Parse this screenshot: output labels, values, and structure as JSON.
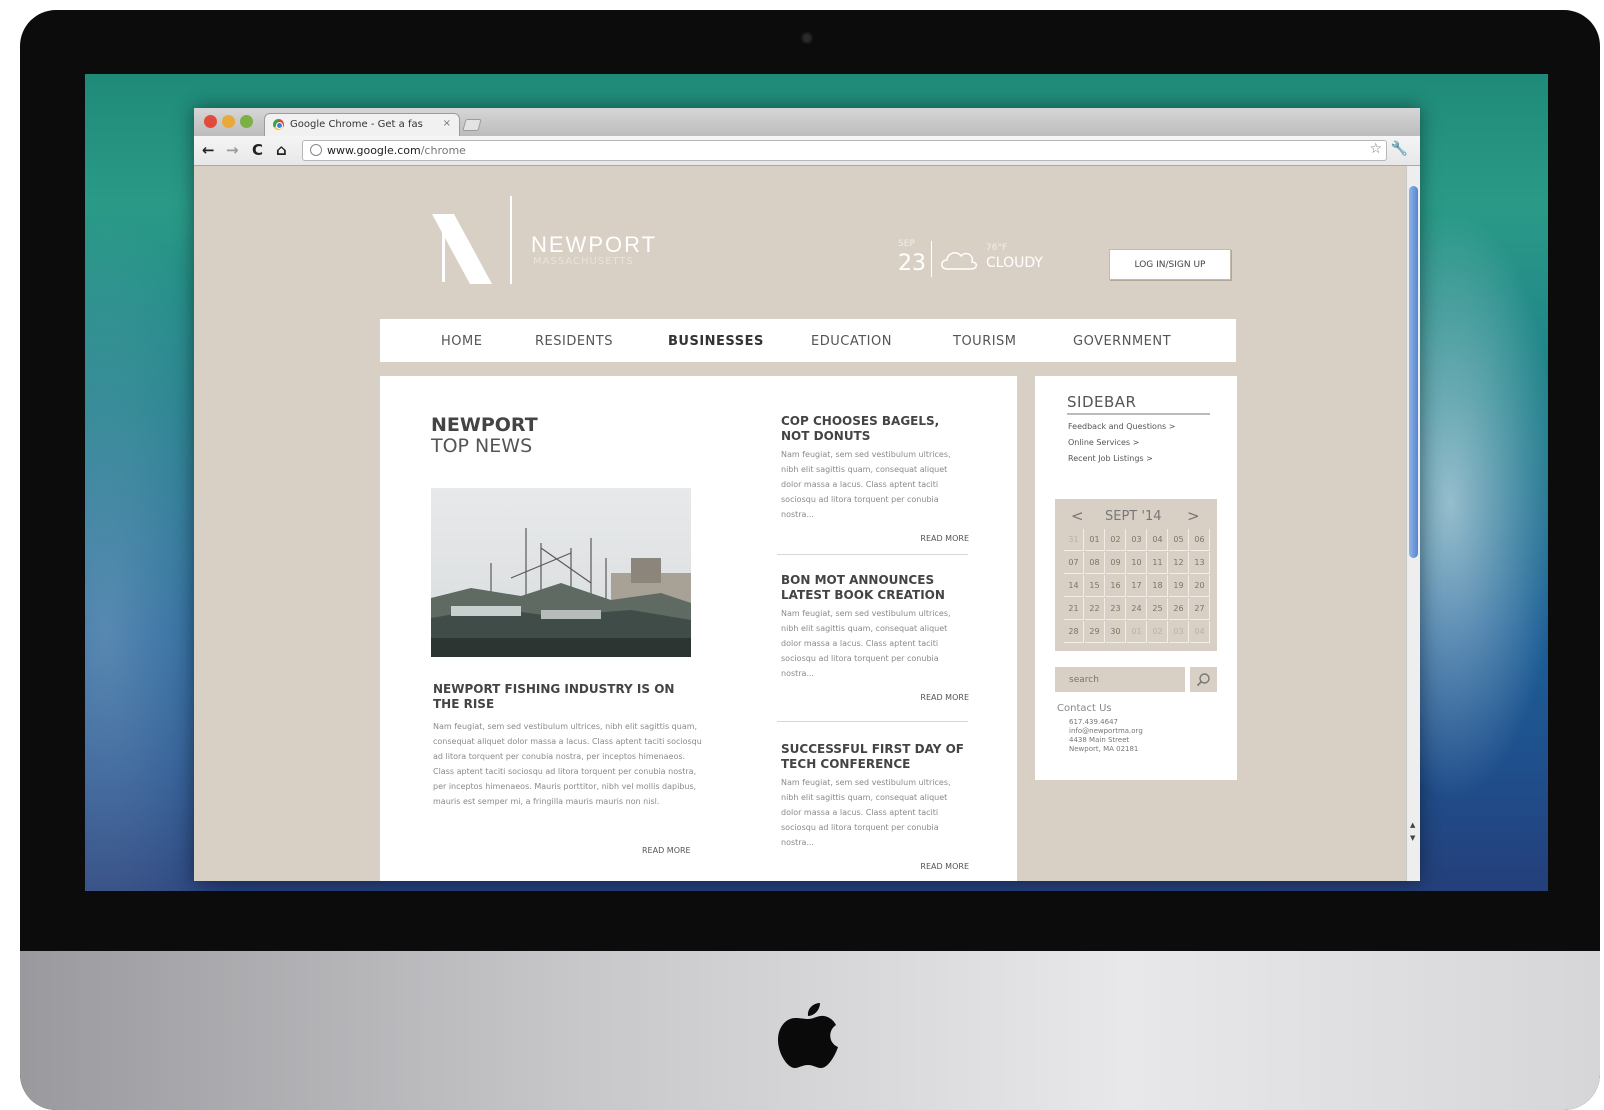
{
  "browser": {
    "tab_title": "Google Chrome - Get a fas",
    "tab_close": "×",
    "url_domain": "www.google.com",
    "url_path": "/chrome",
    "icons": [
      "back-icon",
      "forward-icon",
      "reload-icon",
      "home-icon",
      "star-icon",
      "wrench-icon"
    ]
  },
  "site": {
    "name": "NEWPORT",
    "subtitle": "MASSACHUSETTS",
    "login_label": "LOG IN/SIGN UP",
    "weather": {
      "month": "SEP",
      "day": "23",
      "temp": "76°F",
      "condition": "CLOUDY"
    },
    "colors": {
      "background": "#d8d0c4",
      "panel": "#ffffff",
      "text": "#444444"
    }
  },
  "nav": {
    "items": [
      "HOME",
      "RESIDENTS",
      "BUSINESSES",
      "EDUCATION",
      "TOURISM",
      "GOVERNMENT"
    ],
    "active": "BUSINESSES"
  },
  "main": {
    "heading_line1": "NEWPORT",
    "heading_line2": "TOP NEWS",
    "featured": {
      "title": "NEWPORT FISHING INDUSTRY IS ON THE RISE",
      "body": "Nam feugiat, sem sed vestibulum ultrices, nibh elit sagittis quam, consequat aliquet dolor massa a lacus. Class aptent taciti sociosqu ad litora torquent per conubia nostra, per inceptos himenaeos. Class aptent taciti sociosqu ad litora torquent per conubia nostra, per inceptos himenaeos. Mauris porttitor, nibh vel mollis dapibus, mauris est semper mi, a fringilla mauris mauris non nisl.",
      "more": "READ MORE"
    },
    "stories": [
      {
        "title": "COP CHOOSES BAGELS, NOT DONUTS",
        "body": "Nam feugiat, sem sed vestibulum ultrices, nibh elit sagittis quam, consequat aliquet dolor massa a lacus. Class aptent taciti sociosqu ad litora torquent per conubia nostra...",
        "more": "READ MORE"
      },
      {
        "title": "BON MOT ANNOUNCES LATEST BOOK CREATION",
        "body": "Nam feugiat, sem sed vestibulum ultrices, nibh elit sagittis quam, consequat aliquet dolor massa a lacus. Class aptent taciti sociosqu ad litora torquent per conubia nostra...",
        "more": "READ MORE"
      },
      {
        "title": "SUCCESSFUL FIRST DAY OF TECH CONFERENCE",
        "body": "Nam feugiat, sem sed vestibulum ultrices, nibh elit sagittis quam, consequat aliquet dolor massa a lacus. Class aptent taciti sociosqu ad litora torquent per conubia nostra...",
        "more": "READ MORE"
      }
    ]
  },
  "sidebar": {
    "title": "SIDEBAR",
    "links": [
      "Feedback and Questions >",
      "Online Services >",
      "Recent Job Listings >"
    ],
    "calendar": {
      "month": "SEPT '14",
      "prev": "<",
      "next": ">",
      "rows": [
        [
          "31",
          "01",
          "02",
          "03",
          "04",
          "05",
          "06"
        ],
        [
          "07",
          "08",
          "09",
          "10",
          "11",
          "12",
          "13"
        ],
        [
          "14",
          "15",
          "16",
          "17",
          "18",
          "19",
          "20"
        ],
        [
          "21",
          "22",
          "23",
          "24",
          "25",
          "26",
          "27"
        ],
        [
          "28",
          "29",
          "30",
          "01",
          "02",
          "03",
          "04"
        ]
      ]
    },
    "search_placeholder": "search",
    "contact": {
      "heading": "Contact Us",
      "lines": [
        "617.439.4647",
        "info@newportma.org",
        "4438 Main Street",
        "Newport, MA 02181"
      ]
    }
  }
}
